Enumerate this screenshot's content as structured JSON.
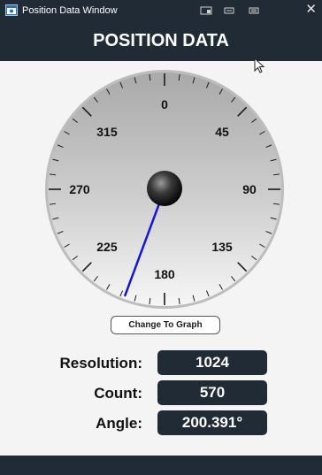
{
  "window": {
    "title": "Position Data Window",
    "icon": "app-window-icon",
    "controls": [
      "minimize-icon",
      "restore-icon",
      "maximize-icon"
    ],
    "close_glyph": "✕"
  },
  "header": {
    "title": "POSITION DATA"
  },
  "gauge": {
    "labels": [
      "0",
      "45",
      "90",
      "135",
      "180",
      "225",
      "270",
      "315"
    ],
    "needle_angle_deg": 200.391,
    "needle_color": "#1515d6"
  },
  "controls": {
    "change_label": "Change To Graph"
  },
  "readouts": [
    {
      "label": "Resolution:",
      "value": "1024"
    },
    {
      "label": "Count:",
      "value": "570"
    },
    {
      "label": "Angle:",
      "value": "200.391°"
    }
  ],
  "colors": {
    "bar": "#212b36",
    "needle": "#1515d6"
  }
}
